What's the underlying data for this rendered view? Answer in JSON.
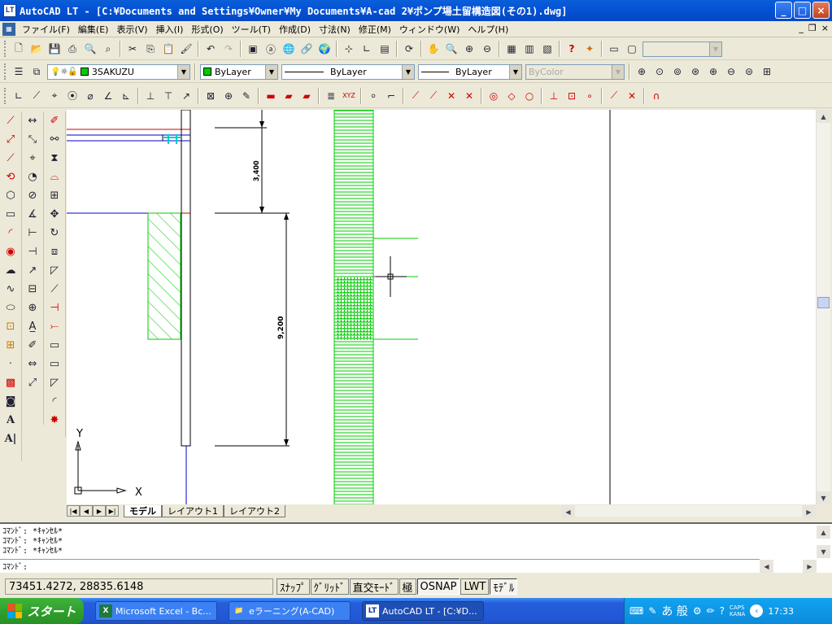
{
  "window": {
    "title": "AutoCAD LT - [C:¥Documents and Settings¥Owner¥My Documents¥A-cad 2¥ポンプ場土留構造図(その1).dwg]",
    "app_icon_text": "LT",
    "minimize": "_",
    "maximize": "□",
    "close": "×"
  },
  "menubar": {
    "items": [
      {
        "label": "ファイル(F)"
      },
      {
        "label": "編集(E)"
      },
      {
        "label": "表示(V)"
      },
      {
        "label": "挿入(I)"
      },
      {
        "label": "形式(O)"
      },
      {
        "label": "ツール(T)"
      },
      {
        "label": "作成(D)"
      },
      {
        "label": "寸法(N)"
      },
      {
        "label": "修正(M)"
      },
      {
        "label": "ウィンドウ(W)"
      },
      {
        "label": "ヘルプ(H)"
      }
    ],
    "mdi_minimize": "_",
    "mdi_restore": "❐",
    "mdi_close": "×"
  },
  "properties": {
    "layer_value": "3SAKUZU",
    "color_value": "ByLayer",
    "linetype_value": "ByLayer",
    "lineweight_value": "ByLayer",
    "plotstyle_value": "ByColor"
  },
  "canvas": {
    "dim_upper": "3,400",
    "dim_lower": "9,200",
    "ucs_x": "X",
    "ucs_y": "Y"
  },
  "layout_tabs": [
    {
      "label": "モデル",
      "active": true
    },
    {
      "label": "レイアウト1",
      "active": false
    },
    {
      "label": "レイアウト2",
      "active": false
    }
  ],
  "command": {
    "history": [
      "ｺﾏﾝﾄﾞ: *ｷｬﾝｾﾙ*",
      "ｺﾏﾝﾄﾞ: *ｷｬﾝｾﾙ*",
      "ｺﾏﾝﾄﾞ: *ｷｬﾝｾﾙ*"
    ],
    "prompt": "ｺﾏﾝﾄﾞ:"
  },
  "status": {
    "coordinates": "73451.4272, 28835.6148",
    "buttons": [
      {
        "label": "ｽﾅｯﾌﾟ",
        "on": false
      },
      {
        "label": "ｸﾞﾘｯﾄﾞ",
        "on": false
      },
      {
        "label": "直交ﾓｰﾄﾞ",
        "on": false
      },
      {
        "label": "極",
        "on": false
      },
      {
        "label": "OSNAP",
        "on": true
      },
      {
        "label": "LWT",
        "on": false
      },
      {
        "label": "ﾓﾃﾞﾙ",
        "on": true
      }
    ]
  },
  "taskbar": {
    "start_label": "スタート",
    "tasks": [
      {
        "label": "Microsoft Excel - Bc...",
        "icon": "X",
        "active": false
      },
      {
        "label": "eラーニング(A-CAD)",
        "icon": "📁",
        "active": false
      },
      {
        "label": "AutoCAD LT - [C:¥D...",
        "icon": "LT",
        "active": true
      }
    ],
    "ime_text": "あ 般",
    "caps": "CAPS",
    "kana": "KANA",
    "clock": "17:33"
  },
  "colors": {
    "hatch_green": "#00cc00",
    "drawing_red": "#cc0000",
    "drawing_blue": "#0000cc",
    "cyan": "#00cccc",
    "magenta": "#cc00cc"
  }
}
